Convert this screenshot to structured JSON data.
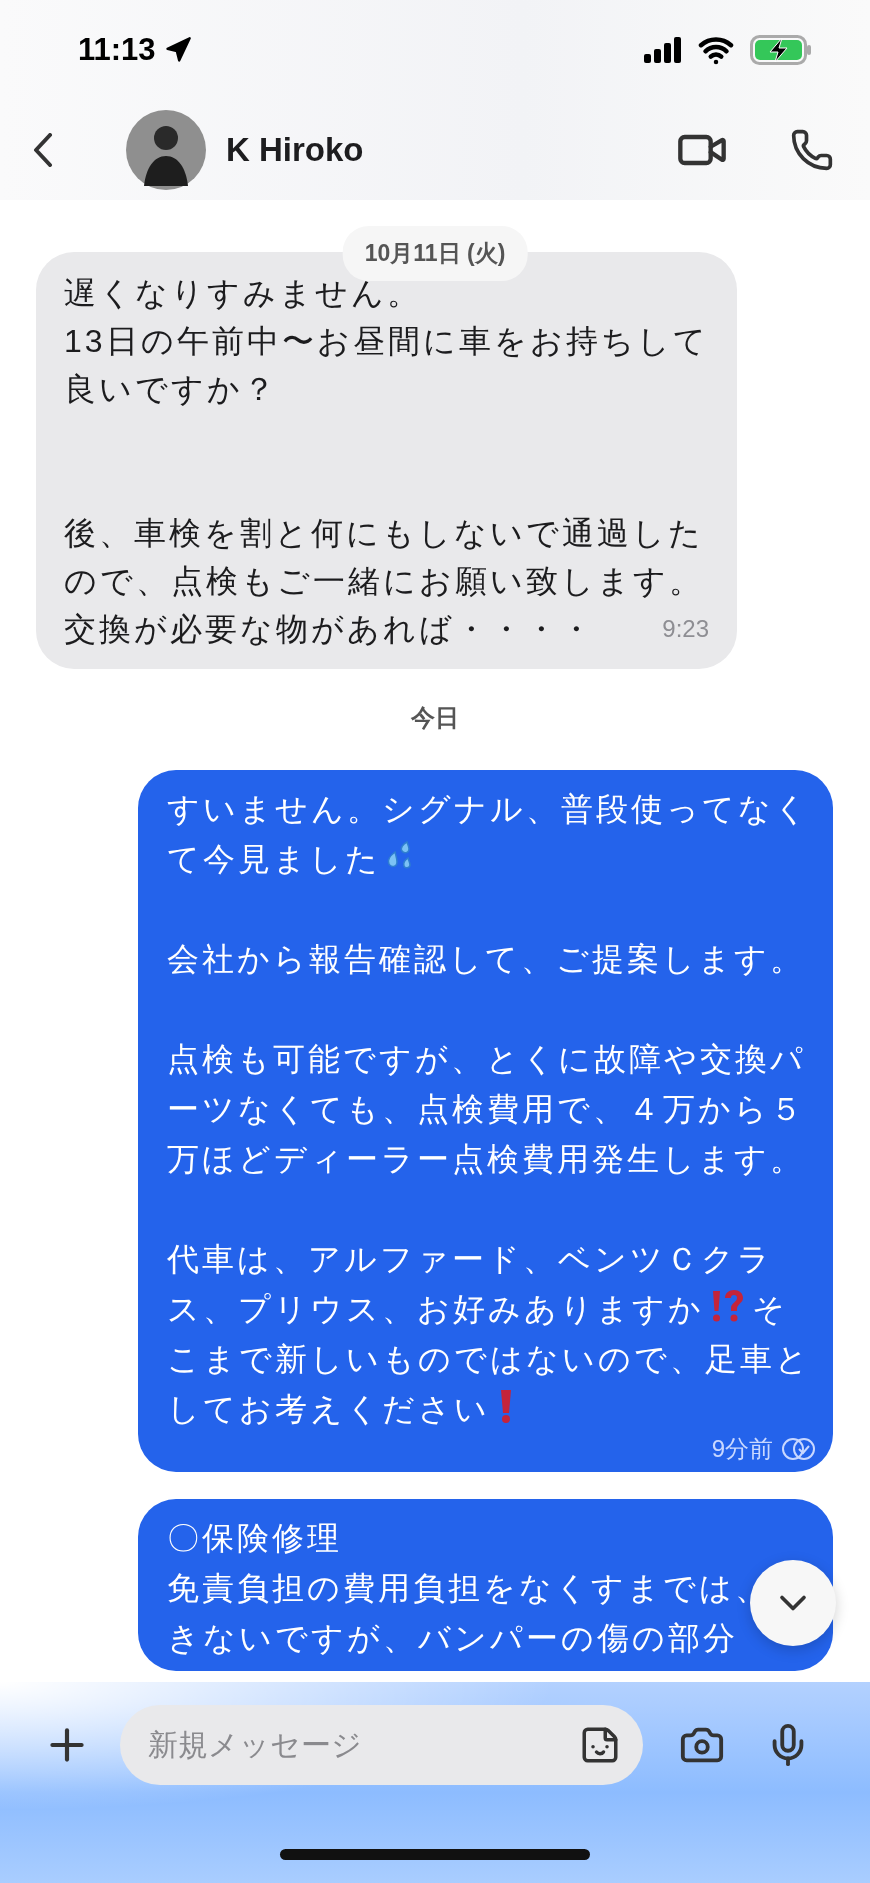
{
  "status_bar": {
    "time": "11:13"
  },
  "header": {
    "contact_name": "K Hiroko"
  },
  "date_pill": "10月11日 (火)",
  "messages": [
    {
      "kind": "incoming",
      "paragraphs": [
        {
          "kind": "text",
          "segments": [
            {
              "kind": "text",
              "text": "遅くなりすみません。"
            }
          ]
        },
        {
          "kind": "text",
          "segments": [
            {
              "kind": "text",
              "text": "13日の午前中〜お昼間に車をお持ちして良いですか？"
            }
          ]
        },
        {
          "kind": "blank"
        },
        {
          "kind": "blank"
        },
        {
          "kind": "text",
          "segments": [
            {
              "kind": "text",
              "text": "後、車検を割と何にもしないで通過したので、点検もご一緒にお願い致します。"
            }
          ]
        },
        {
          "kind": "text",
          "segments": [
            {
              "kind": "text",
              "text": "交換が必要な物があれば・・・・"
            }
          ]
        }
      ],
      "time": "9:23"
    },
    {
      "kind": "divider",
      "label": "今日"
    },
    {
      "kind": "outgoing",
      "paragraphs": [
        {
          "kind": "text",
          "segments": [
            {
              "kind": "text",
              "text": "すいません。シグナル、普段使ってなくて今見ました"
            },
            {
              "kind": "sweat-emoji"
            }
          ]
        },
        {
          "kind": "blank"
        },
        {
          "kind": "text",
          "segments": [
            {
              "kind": "text",
              "text": "会社から報告確認して、ご提案します。"
            }
          ]
        },
        {
          "kind": "blank"
        },
        {
          "kind": "text",
          "segments": [
            {
              "kind": "text",
              "text": "点検も可能ですが、とくに故障や交換パーツなくても、点検費用で、４万から５万ほどディーラー点検費用発生します。"
            }
          ]
        },
        {
          "kind": "blank"
        },
        {
          "kind": "text",
          "segments": [
            {
              "kind": "text",
              "text": "代車は、アルファード、ベンツＣクラス、プリウス、お好みありますか"
            },
            {
              "kind": "interrobang-emoji"
            },
            {
              "kind": "text",
              "text": "そこまで新しいものではないので、足車としてお考えください"
            },
            {
              "kind": "exclamation-emoji"
            }
          ]
        }
      ],
      "time": "9分前"
    },
    {
      "kind": "outgoing",
      "paragraphs": [
        {
          "kind": "text",
          "segments": [
            {
              "kind": "text",
              "text": "〇保険修理"
            }
          ]
        },
        {
          "kind": "text",
          "segments": [
            {
              "kind": "text",
              "text": "免責負担の費用負担をなくすまでは、"
            }
          ]
        },
        {
          "kind": "text",
          "segments": [
            {
              "kind": "text",
              "text": "きないですが、バンパーの傷の部分"
            }
          ]
        }
      ]
    }
  ],
  "composer": {
    "placeholder": "新規メッセージ"
  }
}
